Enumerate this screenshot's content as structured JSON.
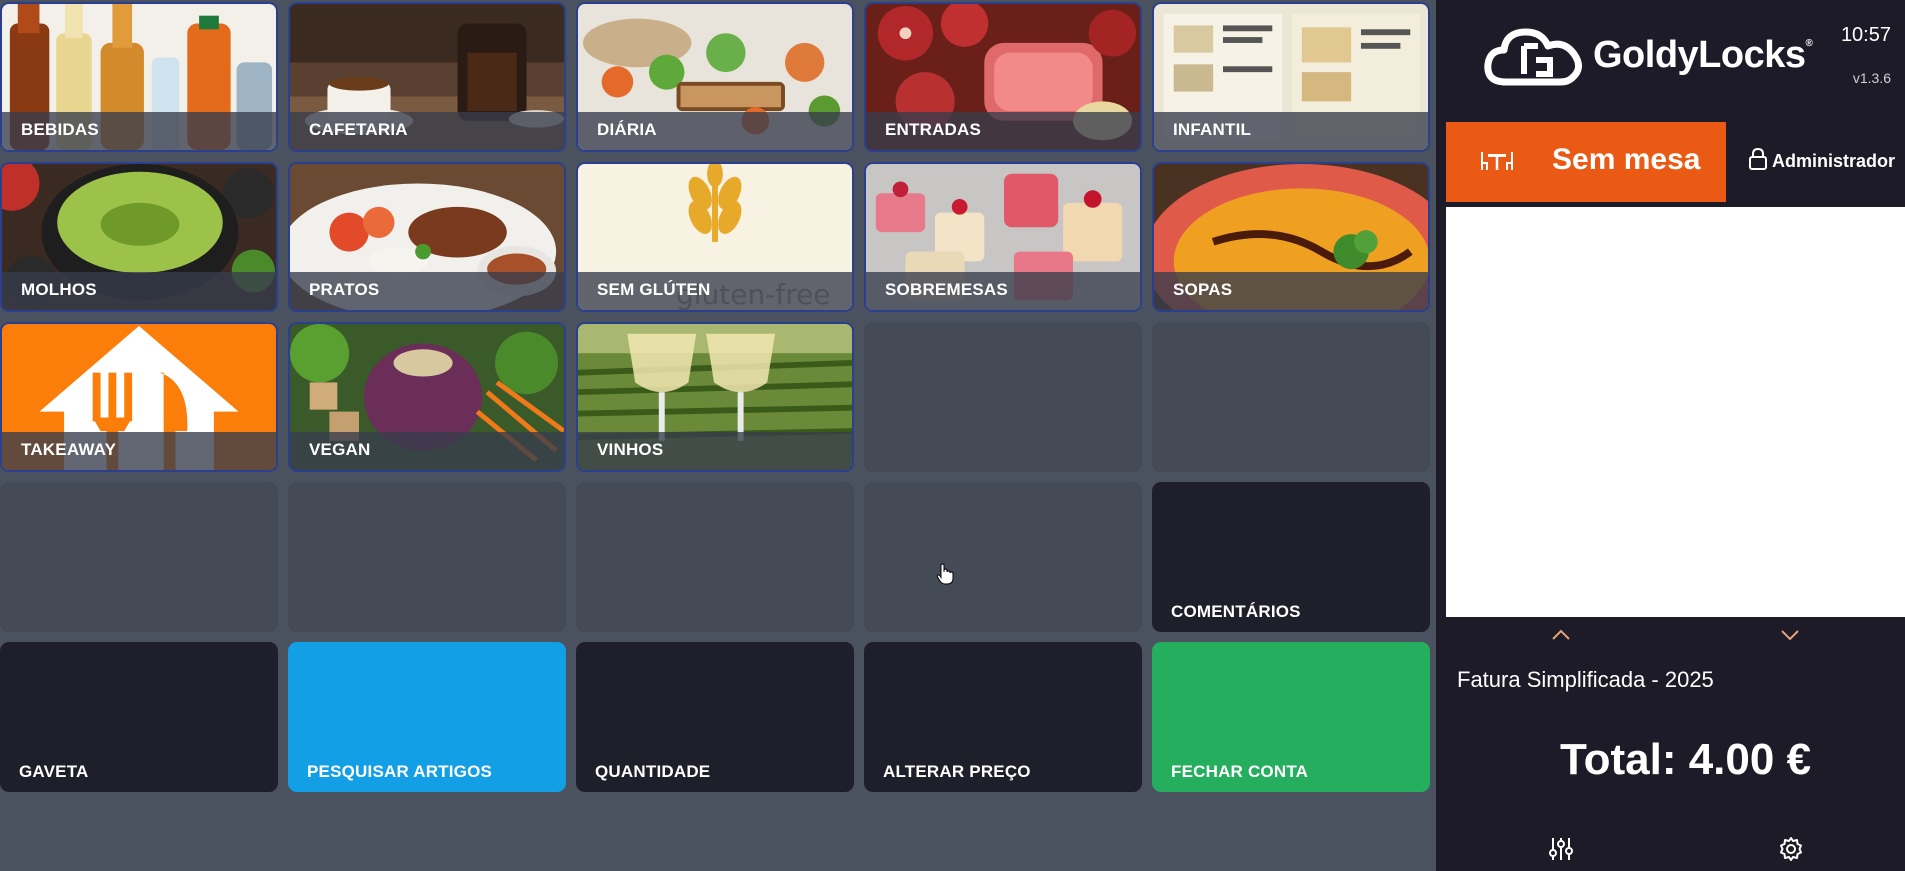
{
  "categories": [
    {
      "label": "BEBIDAS",
      "art": "drinks"
    },
    {
      "label": "CAFETARIA",
      "art": "coffee"
    },
    {
      "label": "DIÁRIA",
      "art": "salad-bread"
    },
    {
      "label": "ENTRADAS",
      "art": "cured-meats"
    },
    {
      "label": "INFANTIL",
      "art": "kids-menu"
    },
    {
      "label": "MOLHOS",
      "art": "guacamole"
    },
    {
      "label": "PRATOS",
      "art": "plate"
    },
    {
      "label": "SEM GLÚTEN",
      "art": "gluten-free"
    },
    {
      "label": "SOBREMESAS",
      "art": "desserts"
    },
    {
      "label": "SOPAS",
      "art": "soup"
    },
    {
      "label": "TAKEAWAY",
      "art": "takeaway-logo"
    },
    {
      "label": "VEGAN",
      "art": "vegan-bowl"
    },
    {
      "label": "VINHOS",
      "art": "wine-vineyard"
    }
  ],
  "actions": {
    "comments": "COMENTÁRIOS",
    "drawer": "GAVETA",
    "search": "PESQUISAR ARTIGOS",
    "quantity": "QUANTIDADE",
    "change_price": "ALTERAR PREÇO",
    "close_bill": "FECHAR CONTA"
  },
  "header": {
    "brand": "GoldyLocks",
    "trademark": "®",
    "clock": "10:57",
    "version": "v1.3.6"
  },
  "table_button": {
    "label": "Sem mesa"
  },
  "user": {
    "name": "Administrador"
  },
  "document": {
    "type": "Fatura Simplificada - 2025"
  },
  "total": {
    "text": "Total: 4.00 €"
  },
  "gluten_watermark": "gluten-free",
  "colors": {
    "accent_orange": "#ea5a14",
    "search_blue": "#139fe6",
    "close_green": "#26ae5f",
    "panel_bg": "#1c1b27",
    "chevron": "#e8a27a"
  },
  "icons": [
    "table-chairs-icon",
    "lock-icon",
    "chevron-up-icon",
    "chevron-down-icon",
    "sliders-icon",
    "gear-icon",
    "cloud-logo-icon"
  ]
}
